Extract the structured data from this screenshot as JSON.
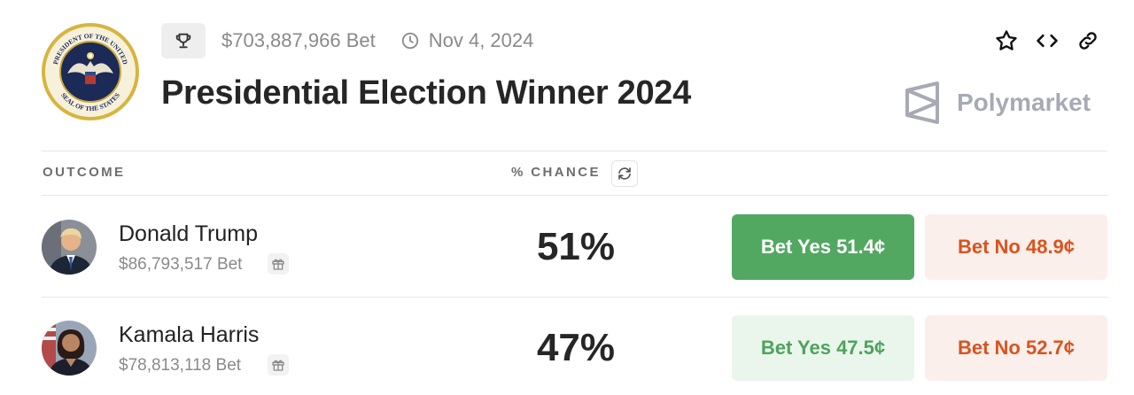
{
  "market": {
    "total_bet": "$703,887,966 Bet",
    "end_date": "Nov 4, 2024",
    "title": "Presidential Election Winner 2024",
    "seal_text_top": "PRESIDENT OF THE UNITED",
    "seal_text_bottom": "SEAL OF THE STATES"
  },
  "brand": {
    "name": "Polymarket"
  },
  "table": {
    "outcome_header": "OUTCOME",
    "chance_header": "% CHANCE"
  },
  "outcomes": [
    {
      "name": "Donald Trump",
      "volume": "$86,793,517 Bet",
      "chance": "51%",
      "yes_label": "Bet Yes 51.4¢",
      "no_label": "Bet No 48.9¢"
    },
    {
      "name": "Kamala Harris",
      "volume": "$78,813,118 Bet",
      "chance": "47%",
      "yes_label": "Bet Yes 47.5¢",
      "no_label": "Bet No 52.7¢"
    }
  ],
  "colors": {
    "yes_primary": "#52a861",
    "yes_soft": "#eaf6ec",
    "no_soft": "#fbefec",
    "no_text": "#d9531e",
    "brand_gray": "#a7aab4"
  },
  "icons": [
    "presidential-seal-icon",
    "trophy-icon",
    "clock-icon",
    "star-icon",
    "embed-code-icon",
    "link-icon",
    "polymarket-logo-icon",
    "refresh-icon",
    "gift-icon"
  ]
}
